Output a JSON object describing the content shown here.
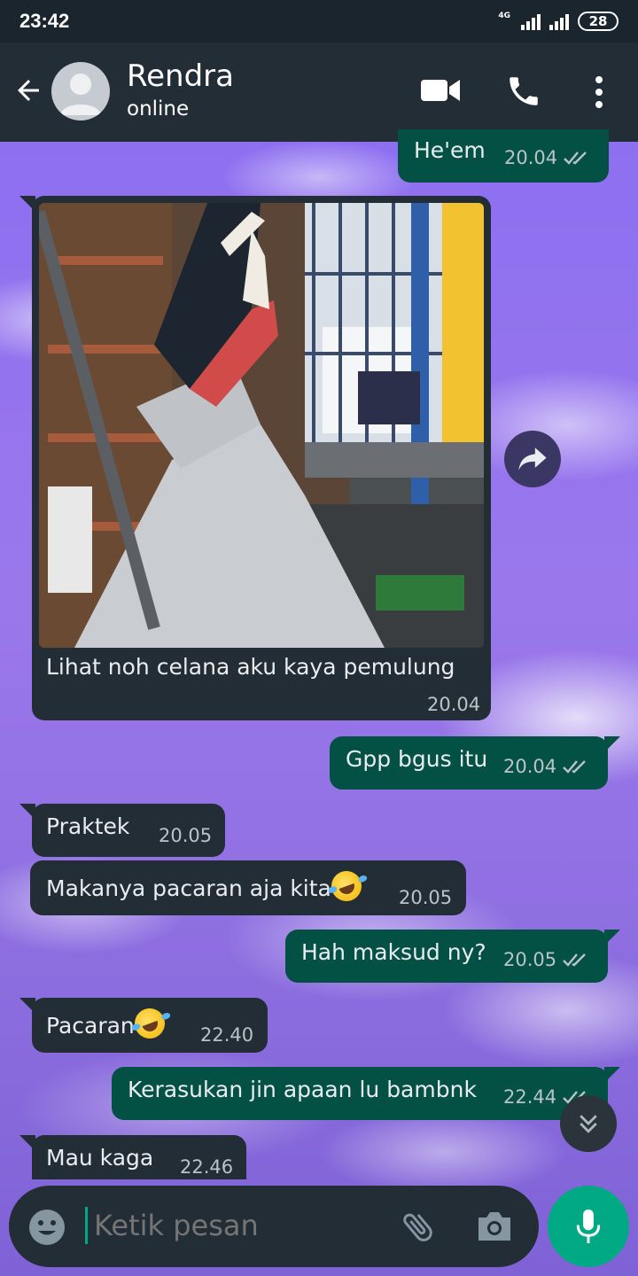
{
  "status_bar": {
    "time": "23:42",
    "network": "4G",
    "battery": "28"
  },
  "header": {
    "contact_name": "Rendra",
    "contact_status": "online"
  },
  "messages": [
    {
      "dir": "out",
      "text": "He'em",
      "time": "20.04",
      "read": true
    },
    {
      "dir": "in",
      "type": "image",
      "caption": "Lihat noh celana aku kaya pemulung",
      "time": "20.04"
    },
    {
      "dir": "out",
      "text": "Gpp bgus itu",
      "time": "20.04",
      "read": true
    },
    {
      "dir": "in",
      "text": "Praktek",
      "time": "20.05"
    },
    {
      "dir": "in",
      "text": "Makanya pacaran aja kita",
      "emoji": "rolling-on-floor-laughing",
      "time": "20.05"
    },
    {
      "dir": "out",
      "text": "Hah maksud ny?",
      "time": "20.05",
      "read": true
    },
    {
      "dir": "in",
      "text": "Pacaran",
      "emoji": "rolling-on-floor-laughing",
      "time": "22.40"
    },
    {
      "dir": "out",
      "text": "Kerasukan jin apaan lu bambnk",
      "time": "22.44",
      "read": true
    },
    {
      "dir": "in",
      "text": "Mau kaga",
      "time": "22.46"
    }
  ],
  "composer": {
    "placeholder": "Ketik pesan"
  },
  "colors": {
    "app_bar": "#232d36",
    "incoming_bubble": "#232d36",
    "outgoing_bubble": "#025144",
    "accent": "#00a884",
    "read_ticks": "#b9c4c9"
  },
  "icons": [
    "back-arrow-icon",
    "avatar-icon",
    "video-call-icon",
    "phone-icon",
    "more-vert-icon",
    "forward-icon",
    "double-chevron-down-icon",
    "emoji-icon",
    "attach-icon",
    "camera-icon",
    "mic-icon"
  ]
}
